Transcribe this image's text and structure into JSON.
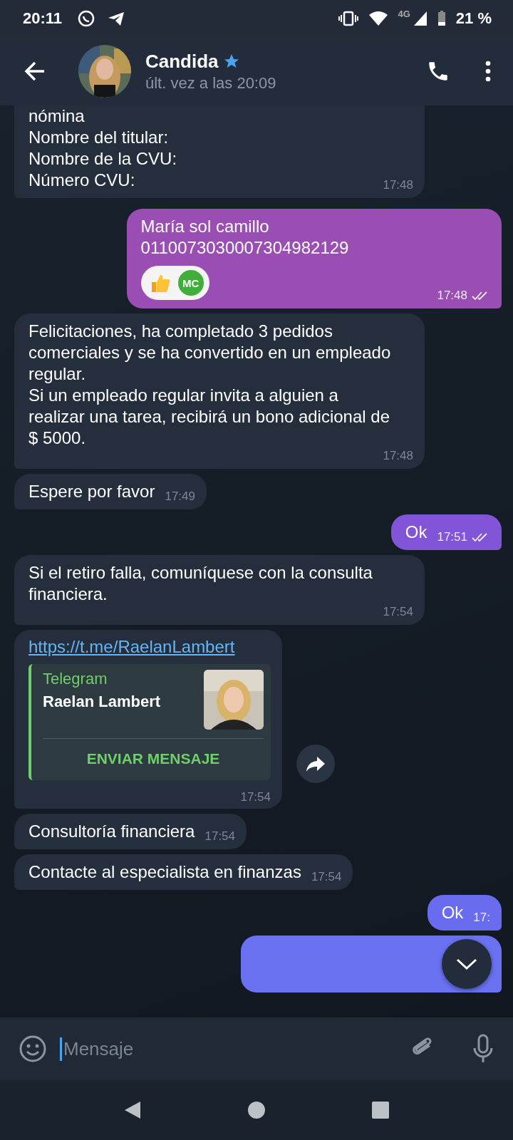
{
  "status_bar": {
    "time": "20:11",
    "network": "4G",
    "battery": "21 %"
  },
  "header": {
    "name": "Candida",
    "verified": true,
    "status": "últ. vez a las 20:09"
  },
  "messages": [
    {
      "kind": "text",
      "outgoing": false,
      "text": "nómina\nNombre del titular:\nNombre de la CVU:\nNúmero CVU:",
      "time": "17:48",
      "cut_top": true
    },
    {
      "kind": "text",
      "outgoing": true,
      "color": "#9a4eb4",
      "text": "María sol camillo\n0110073030007304982129",
      "time": "17:48",
      "read": true,
      "reaction": {
        "kind": "like",
        "initials": "MC"
      }
    },
    {
      "kind": "text",
      "outgoing": false,
      "text": "Felicitaciones, ha completado 3 pedidos comerciales y se ha convertido en un empleado regular.\nSi un empleado regular invita a alguien a realizar una tarea, recibirá un bono adicional de $ 5000.",
      "time": "17:48"
    },
    {
      "kind": "text",
      "outgoing": false,
      "text": "Espere por favor",
      "time": "17:49"
    },
    {
      "kind": "text",
      "outgoing": true,
      "color": "#8254d8",
      "text": "Ok",
      "time": "17:51",
      "read": true
    },
    {
      "kind": "text",
      "outgoing": false,
      "text": "Si el retiro falla, comuníquese con la consulta financiera.",
      "time": "17:54"
    },
    {
      "kind": "link",
      "outgoing": false,
      "url": "https://t.me/RaelanLambert",
      "site": "Telegram",
      "title": "Raelan Lambert",
      "action": "ENVIAR MENSAJE",
      "time": "17:54"
    },
    {
      "kind": "text",
      "outgoing": false,
      "text": "Consultoría financiera",
      "time": "17:54"
    },
    {
      "kind": "text",
      "outgoing": false,
      "text": "Contacte al especialista en finanzas",
      "time": "17:54"
    },
    {
      "kind": "text",
      "outgoing": true,
      "color": "#6a6cf0",
      "text": "Ok",
      "time": "17:",
      "read": false
    },
    {
      "kind": "hidden",
      "outgoing": true,
      "color": "#6a72f2"
    }
  ],
  "composer": {
    "placeholder": "Mensaje"
  }
}
